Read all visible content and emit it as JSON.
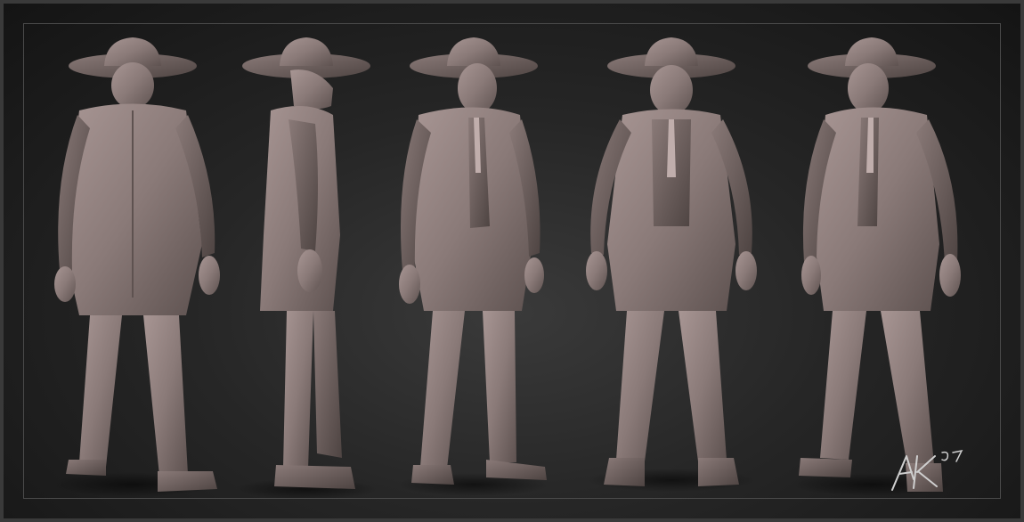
{
  "render": {
    "background_color": "#1b1b1b",
    "clay_color": "#8a7a78",
    "clay_shadow": "#5e5250",
    "clay_highlight": "#a89694"
  },
  "views": [
    {
      "name": "back-view"
    },
    {
      "name": "side-view"
    },
    {
      "name": "three-quarter-left-view"
    },
    {
      "name": "front-view"
    },
    {
      "name": "three-quarter-right-view"
    }
  ],
  "signature": {
    "text": "AK 07"
  }
}
